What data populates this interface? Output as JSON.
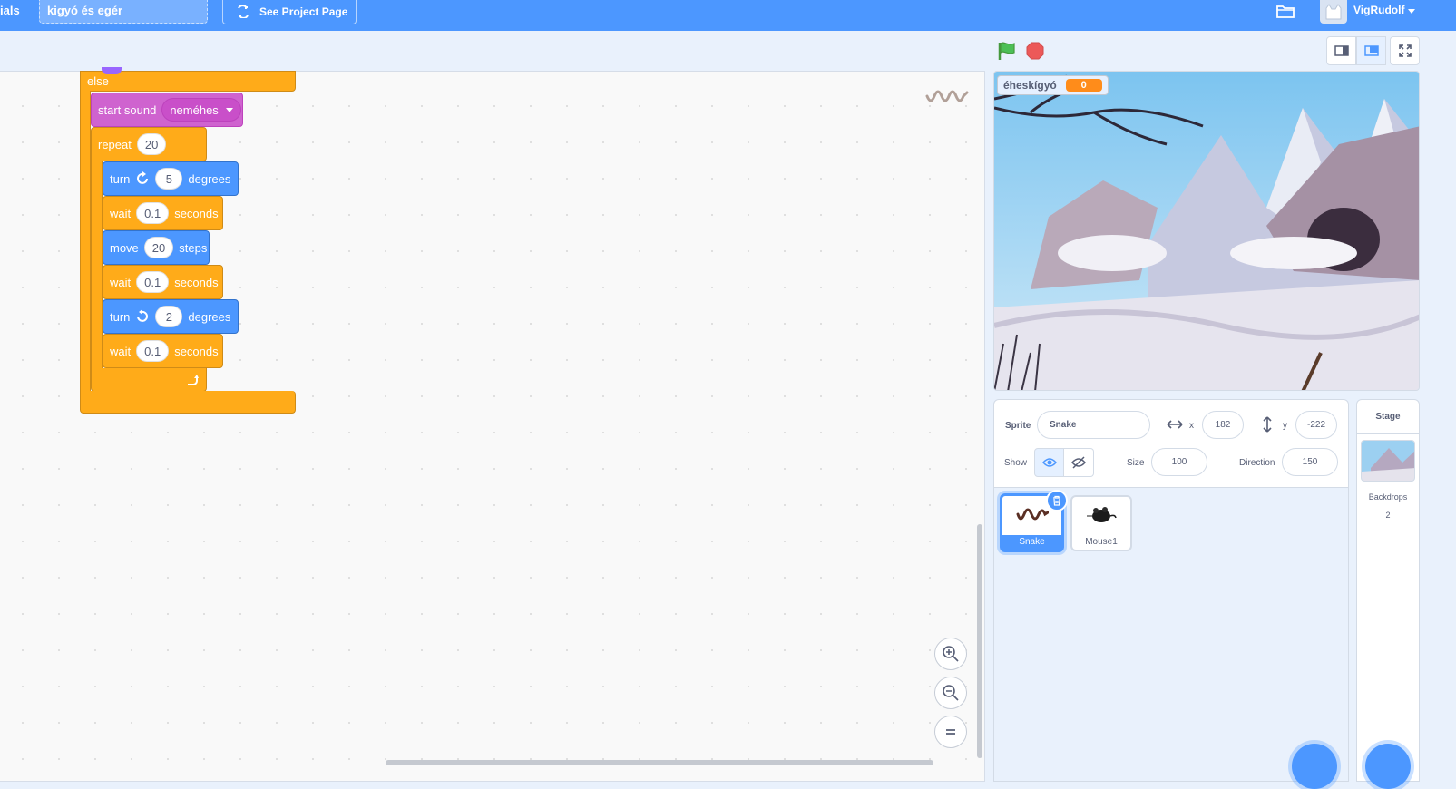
{
  "menu": {
    "partial_label": "ials",
    "project_title": "kigyó és egér",
    "see_project_page": "See Project Page",
    "username": "VigRudolf"
  },
  "code": {
    "else_label": "else",
    "start_sound": {
      "label": "start sound",
      "sound": "neméhes"
    },
    "repeat": {
      "label": "repeat",
      "count": "20"
    },
    "turn_right": {
      "label": "turn",
      "value": "5",
      "unit": "degrees"
    },
    "wait1": {
      "label": "wait",
      "value": "0.1",
      "unit": "seconds"
    },
    "move": {
      "label": "move",
      "value": "20",
      "unit": "steps"
    },
    "wait2": {
      "label": "wait",
      "value": "0.1",
      "unit": "seconds"
    },
    "turn_left": {
      "label": "turn",
      "value": "2",
      "unit": "degrees"
    },
    "wait3": {
      "label": "wait",
      "value": "0.1",
      "unit": "seconds"
    }
  },
  "stage": {
    "variable_name": "éheskígyó",
    "variable_value": "0"
  },
  "sprite_info": {
    "sprite_label": "Sprite",
    "sprite_name": "Snake",
    "x_label": "x",
    "x_value": "182",
    "y_label": "y",
    "y_value": "-222",
    "show_label": "Show",
    "size_label": "Size",
    "size_value": "100",
    "direction_label": "Direction",
    "direction_value": "150"
  },
  "sprites": [
    {
      "name": "Snake",
      "selected": true
    },
    {
      "name": "Mouse1",
      "selected": false
    }
  ],
  "stage_panel": {
    "title": "Stage",
    "backdrops_label": "Backdrops",
    "backdrops_count": "2"
  },
  "colors": {
    "menu_blue": "#4c97ff",
    "control_orange": "#ffab19",
    "motion_blue": "#4c97ff",
    "sound_purple": "#cf63cf",
    "variable_orange": "#ff8c1a"
  }
}
